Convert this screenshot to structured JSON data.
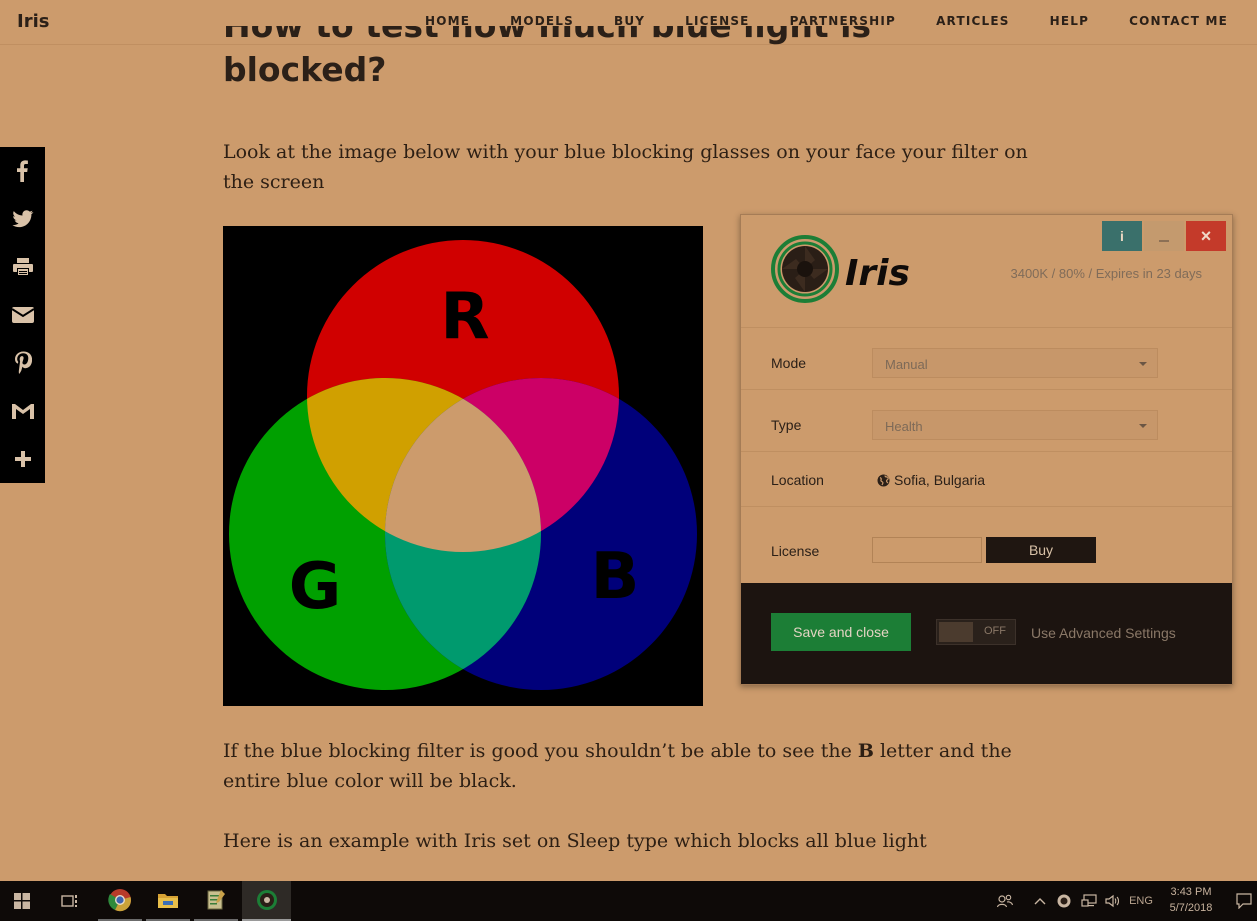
{
  "site": {
    "brand": "Iris",
    "nav": [
      "HOME",
      "MODELS",
      "BUY",
      "LICENSE",
      "PARTNERSHIP",
      "ARTICLES",
      "HELP",
      "CONTACT ME"
    ]
  },
  "article": {
    "heading_line1": "How to test how much blue light is",
    "heading_line2": "blocked?",
    "intro": "Look at the image below with your blue blocking glasses on your face your filter on the screen",
    "result_before": "If the blue blocking filter is good you shouldn’t be able to see the ",
    "result_bold": "B",
    "result_after": " letter and the entire blue color will be black.",
    "example": "Here is an example with Iris set on Sleep type which blocks all blue light",
    "rgb_letters": {
      "r": "R",
      "g": "G",
      "b": "B"
    },
    "rgb_colors": {
      "red": "#d00000",
      "green": "#00a000",
      "blue": "#00007a",
      "yellow": "#d0a000",
      "magenta": "#cc0066",
      "cyan": "#009a6e",
      "white": "#cc9b6c"
    }
  },
  "share": [
    "facebook-icon",
    "twitter-icon",
    "print-icon",
    "email-icon",
    "pinterest-icon",
    "gmail-icon",
    "plus-icon"
  ],
  "iris_app": {
    "logo_text": "Iris",
    "status": "3400K / 80% / Expires in 23 days",
    "mode_label": "Mode",
    "mode_value": "Manual",
    "type_label": "Type",
    "type_value": "Health",
    "location_label": "Location",
    "location_value": "Sofia, Bulgaria",
    "license_label": "License",
    "license_value": "",
    "buy_label": "Buy",
    "save_label": "Save and close",
    "toggle_label": "OFF",
    "advanced_label": "Use Advanced Settings",
    "info_label": "i",
    "close_label": "×",
    "colors": {
      "info": "#3a706b",
      "minimize": "#c49a6e",
      "close": "#c43a2a",
      "save": "#1c7e36"
    }
  },
  "taskbar": {
    "language": "ENG",
    "time": "3:43 PM",
    "date": "5/7/2018"
  }
}
